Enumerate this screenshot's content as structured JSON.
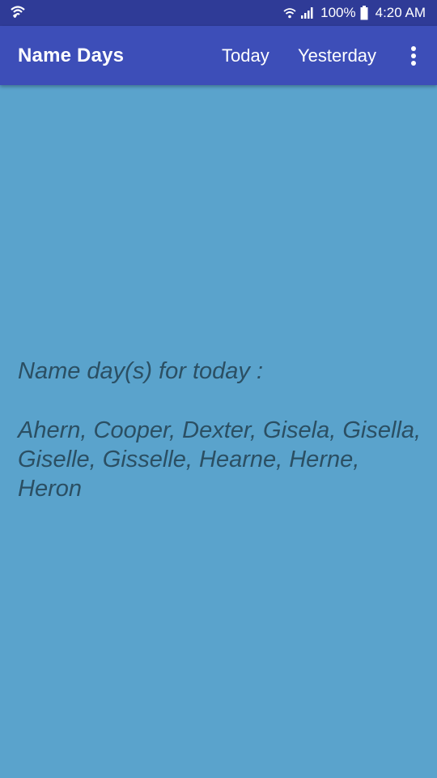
{
  "status_bar": {
    "battery": "100%",
    "time": "4:20 AM",
    "icons": [
      "wifi-calling-icon",
      "wifi-icon",
      "signal-icon",
      "battery-icon"
    ]
  },
  "app_bar": {
    "title": "Name Days",
    "actions": {
      "today": "Today",
      "yesterday": "Yesterday"
    },
    "overflow_icon": "more-vert-icon"
  },
  "main": {
    "heading": "Name day(s) for today :",
    "names": "Ahern, Cooper, Dexter, Gisela, Gisella, Giselle, Gisselle, Hearne, Herne, Heron"
  },
  "colors": {
    "status_bar": "#2f3b97",
    "app_bar": "#3d4eb8",
    "background": "#5aa3cc",
    "text": "#2b4f63"
  }
}
